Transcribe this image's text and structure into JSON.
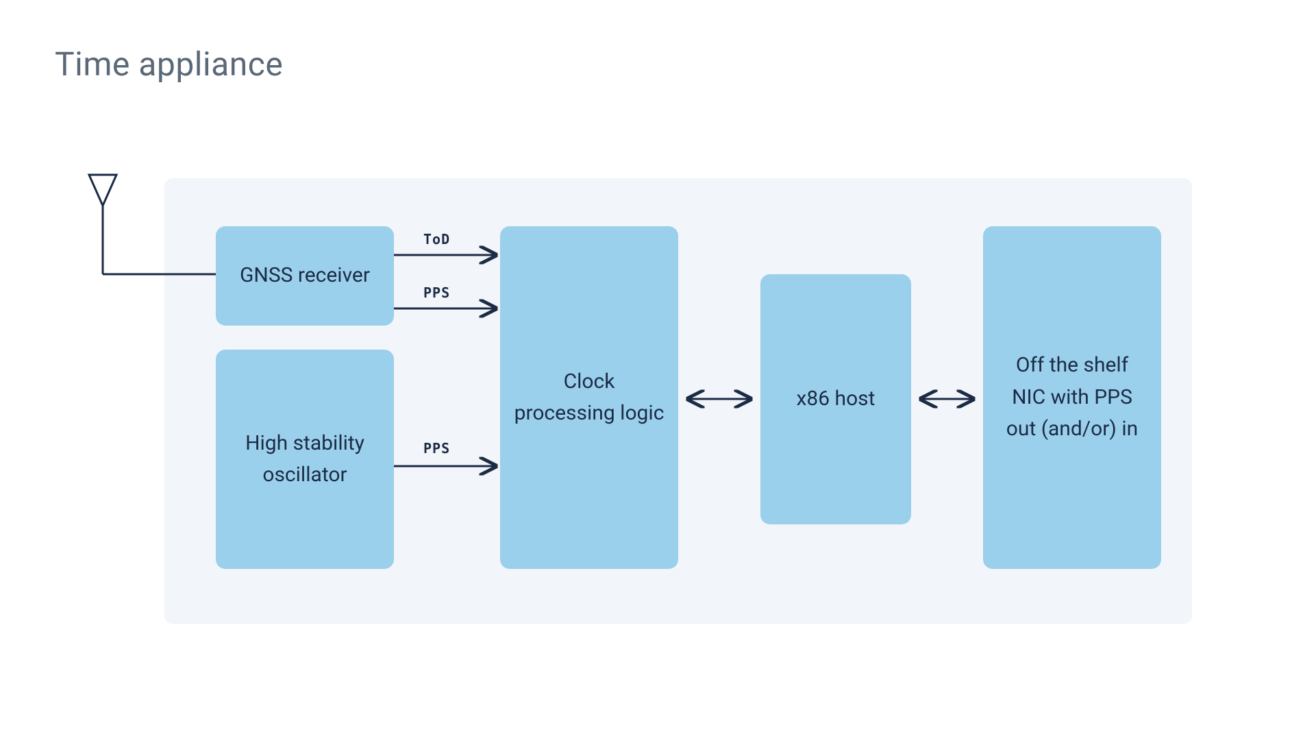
{
  "title": "Time appliance",
  "blocks": {
    "gnss": "GNSS receiver",
    "osc": "High stability oscillator",
    "clock": "Clock processing logic",
    "host": "x86 host",
    "nic": "Off the shelf NIC with PPS out (and/or) in"
  },
  "labels": {
    "tod": "ToD",
    "pps1": "PPS",
    "pps2": "PPS"
  },
  "colors": {
    "block_bg": "#9ad0ec",
    "container_bg": "#f2f5f9",
    "title_color": "#5a6878",
    "text_color": "#1c2b45",
    "line_color": "#1c2b45"
  }
}
